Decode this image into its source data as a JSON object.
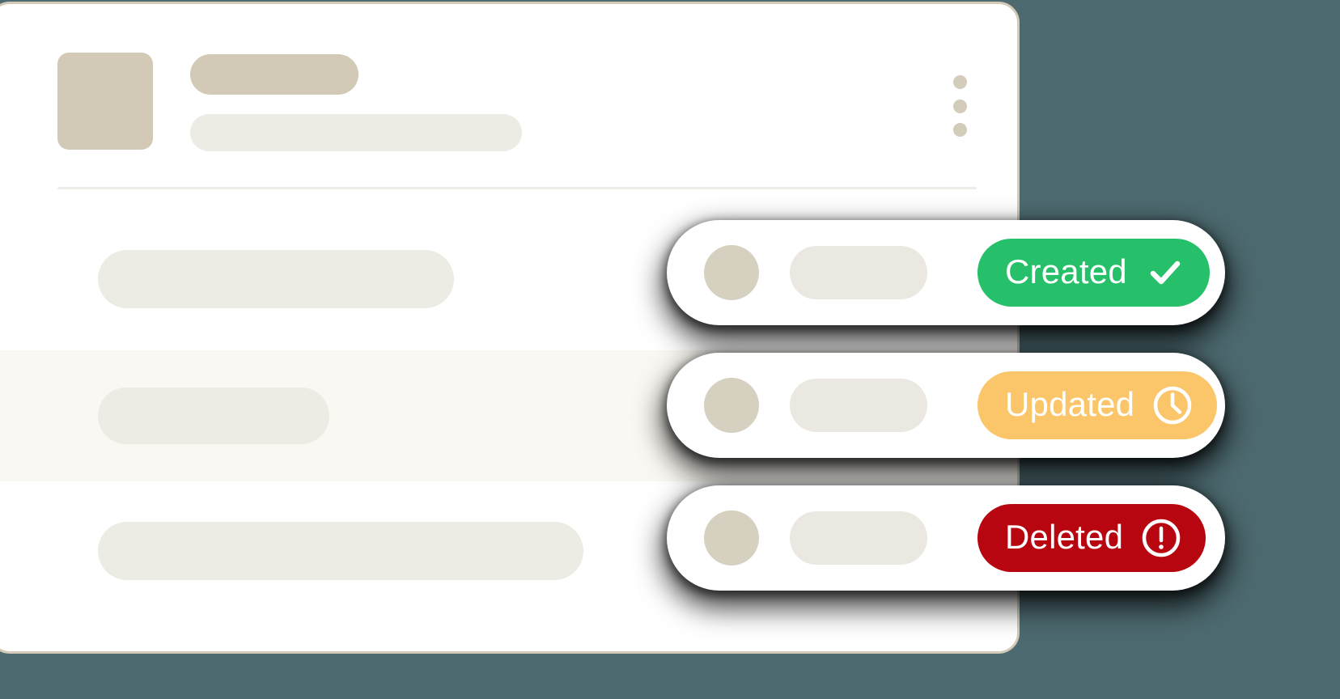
{
  "theme": {
    "page_background": "#4d6a70",
    "card_background": "#ffffff",
    "card_border": "#d3cbb7",
    "placeholder_dark": "#d2cab6",
    "placeholder_light": "#ecebe4",
    "row_highlight": "#faf8f2",
    "divider": "#eeece6"
  },
  "main_card": {
    "header": {
      "avatar_placeholder": "avatar-tile-placeholder",
      "title_placeholder": "title-bar-placeholder",
      "subtitle_placeholder": "subtitle-bar-placeholder",
      "overflow_menu": "kebab-menu",
      "overflow_menu_dots": 3
    },
    "rows": [
      {
        "id": "row-1",
        "highlighted": false,
        "content_placeholder": "content-bar-placeholder"
      },
      {
        "id": "row-2",
        "highlighted": true,
        "content_placeholder": "content-bar-placeholder"
      },
      {
        "id": "row-3",
        "highlighted": false,
        "content_placeholder": "content-bar-placeholder"
      }
    ]
  },
  "status_cards": [
    {
      "id": "created",
      "label": "Created",
      "icon": "check-icon",
      "color": "#27c06a",
      "text_color": "#ffffff",
      "avatar_placeholder": "avatar-circle-placeholder",
      "content_placeholder": "content-bar-placeholder"
    },
    {
      "id": "updated",
      "label": "Updated",
      "icon": "clock-icon",
      "color": "#fbc56a",
      "text_color": "#ffffff",
      "avatar_placeholder": "avatar-circle-placeholder",
      "content_placeholder": "content-bar-placeholder"
    },
    {
      "id": "deleted",
      "label": "Deleted",
      "icon": "exclamation-circle-icon",
      "color": "#b80610",
      "text_color": "#ffffff",
      "avatar_placeholder": "avatar-circle-placeholder",
      "content_placeholder": "content-bar-placeholder"
    }
  ]
}
